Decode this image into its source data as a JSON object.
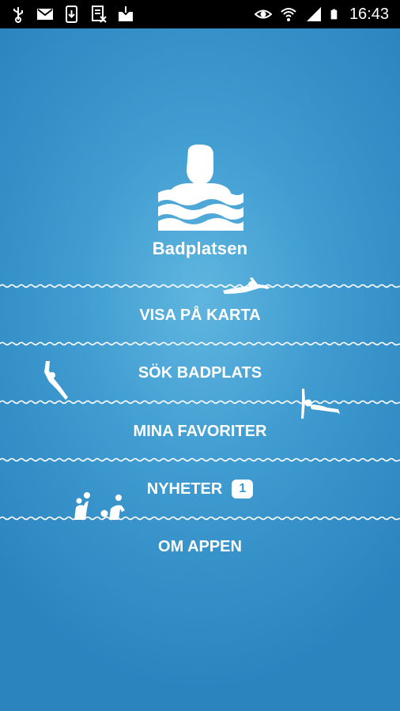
{
  "status_bar": {
    "time": "16:43",
    "left_icons": [
      "usb-icon",
      "gmail-icon",
      "phone-download-icon",
      "document-x-icon",
      "download-box-icon"
    ],
    "right_icons": [
      "eye-icon",
      "wifi-icon",
      "signal-icon",
      "battery-icon"
    ]
  },
  "app": {
    "name": "Badplatsen",
    "background_color": "#3f9bd0",
    "accent_color": "#ffffff"
  },
  "menu": {
    "items": [
      {
        "label": "VISA PÅ KARTA"
      },
      {
        "label": "SÖK BADPLATS"
      },
      {
        "label": "MINA FAVORITER"
      },
      {
        "label": "NYHETER",
        "badge": "1"
      },
      {
        "label": "OM APPEN"
      }
    ]
  },
  "decorations": [
    "swimmer-crawl-icon",
    "diver-icon",
    "backstroke-swimmer-icon",
    "water-polo-players-icon"
  ]
}
